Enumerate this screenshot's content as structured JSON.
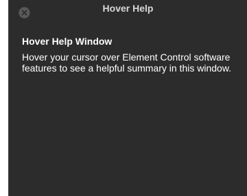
{
  "window": {
    "title": "Hover Help",
    "close_icon": "close-circle-icon"
  },
  "help": {
    "heading": "Hover Help Window",
    "body": "Hover your cursor over Element Control software features to see a helpful summary in this window."
  },
  "colors": {
    "window_background": "#2c2c2c",
    "title_text": "#d8d8d8",
    "body_text": "#ffffff",
    "close_button": "#5a5a5a"
  }
}
